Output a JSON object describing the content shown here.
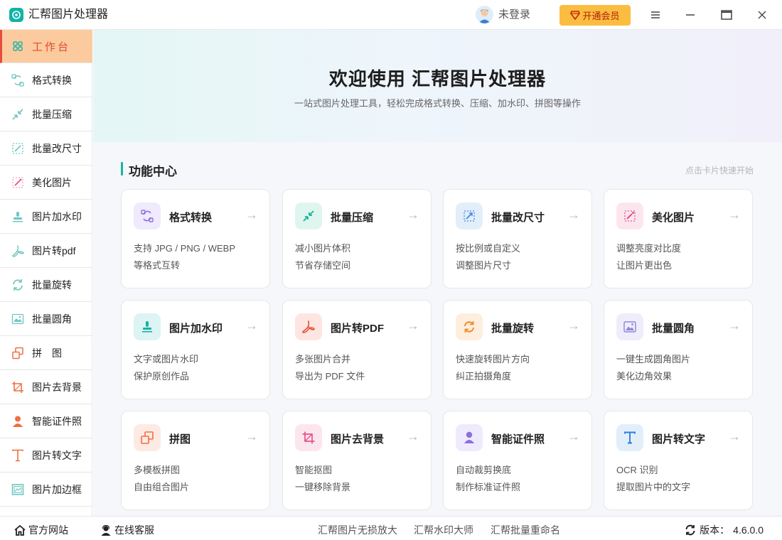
{
  "app": {
    "title": "汇帮图片处理器",
    "login_text": "未登录",
    "vip_label": "开通会员"
  },
  "sidebar": {
    "items": [
      {
        "label": "工作台",
        "icon": "grid-icon"
      },
      {
        "label": "格式转换",
        "icon": "convert-icon"
      },
      {
        "label": "批量压缩",
        "icon": "compress-icon"
      },
      {
        "label": "批量改尺寸",
        "icon": "resize-icon"
      },
      {
        "label": "美化图片",
        "icon": "beautify-icon"
      },
      {
        "label": "图片加水印",
        "icon": "stamp-icon"
      },
      {
        "label": "图片转pdf",
        "icon": "pdf-icon"
      },
      {
        "label": "批量旋转",
        "icon": "rotate-icon"
      },
      {
        "label": "批量圆角",
        "icon": "image-icon"
      },
      {
        "label": "拼　图",
        "icon": "collage-icon"
      },
      {
        "label": "图片去背景",
        "icon": "crop-icon"
      },
      {
        "label": "智能证件照",
        "icon": "person-icon"
      },
      {
        "label": "图片转文字",
        "icon": "text-icon"
      },
      {
        "label": "图片加边框",
        "icon": "frame-icon"
      }
    ]
  },
  "hero": {
    "title": "欢迎使用 汇帮图片处理器",
    "subtitle": "一站式图片处理工具，轻松完成格式转换、压缩、加水印、拼图等操作"
  },
  "section": {
    "title": "功能中心",
    "hint": "点击卡片快速开始"
  },
  "cards": [
    {
      "title": "格式转换",
      "arrow": "→",
      "desc1": "支持 JPG / PNG / WEBP",
      "desc2": "等格式互转",
      "icon": "convert-icon",
      "color": "#8b6fe0",
      "bg": "#efeafc"
    },
    {
      "title": "批量压缩",
      "arrow": "→",
      "desc1": "减小图片体积",
      "desc2": "节省存储空间",
      "icon": "compress-icon",
      "color": "#19b394",
      "bg": "#dff6f0"
    },
    {
      "title": "批量改尺寸",
      "arrow": "→",
      "desc1": "按比例或自定义",
      "desc2": "调整图片尺寸",
      "icon": "resize-icon",
      "color": "#3d86e6",
      "bg": "#e3eefb"
    },
    {
      "title": "美化图片",
      "arrow": "→",
      "desc1": "调整亮度对比度",
      "desc2": "让图片更出色",
      "icon": "beautify-icon",
      "color": "#e8508a",
      "bg": "#fce6ee"
    },
    {
      "title": "图片加水印",
      "arrow": "→",
      "desc1": "文字或图片水印",
      "desc2": "保护原创作品",
      "icon": "stamp-icon",
      "color": "#17b3a3",
      "bg": "#dcf4f3"
    },
    {
      "title": "图片转PDF",
      "arrow": "→",
      "desc1": "多张图片合并",
      "desc2": "导出为 PDF 文件",
      "icon": "pdf-icon",
      "color": "#e8553e",
      "bg": "#fde6e2"
    },
    {
      "title": "批量旋转",
      "arrow": "→",
      "desc1": "快速旋转图片方向",
      "desc2": "纠正拍摄角度",
      "icon": "rotate-icon",
      "color": "#f08a2c",
      "bg": "#fdeedd"
    },
    {
      "title": "批量圆角",
      "arrow": "→",
      "desc1": "一键生成圆角图片",
      "desc2": "美化边角效果",
      "icon": "image-icon",
      "color": "#8c86d8",
      "bg": "#efedfb"
    },
    {
      "title": "拼图",
      "arrow": "→",
      "desc1": "多模板拼图",
      "desc2": "自由组合图片",
      "icon": "collage-icon",
      "color": "#ee6f45",
      "bg": "#fdeae3"
    },
    {
      "title": "图片去背景",
      "arrow": "→",
      "desc1": "智能抠图",
      "desc2": "一键移除背景",
      "icon": "crop-icon",
      "color": "#e8508a",
      "bg": "#fce6ee"
    },
    {
      "title": "智能证件照",
      "arrow": "→",
      "desc1": "自动裁剪换底",
      "desc2": "制作标准证件照",
      "icon": "person-icon",
      "color": "#8b6fe0",
      "bg": "#efeafc"
    },
    {
      "title": "图片转文字",
      "arrow": "→",
      "desc1": "OCR 识别",
      "desc2": "提取图片中的文字",
      "icon": "text-icon",
      "color": "#2a7fe0",
      "bg": "#e3eefb"
    }
  ],
  "footer": {
    "website": "官方网站",
    "support": "在线客服",
    "links": [
      "汇帮图片无损放大",
      "汇帮水印大师",
      "汇帮批量重命名"
    ],
    "version_label": "版本：",
    "version_value": "4.6.0.0"
  }
}
